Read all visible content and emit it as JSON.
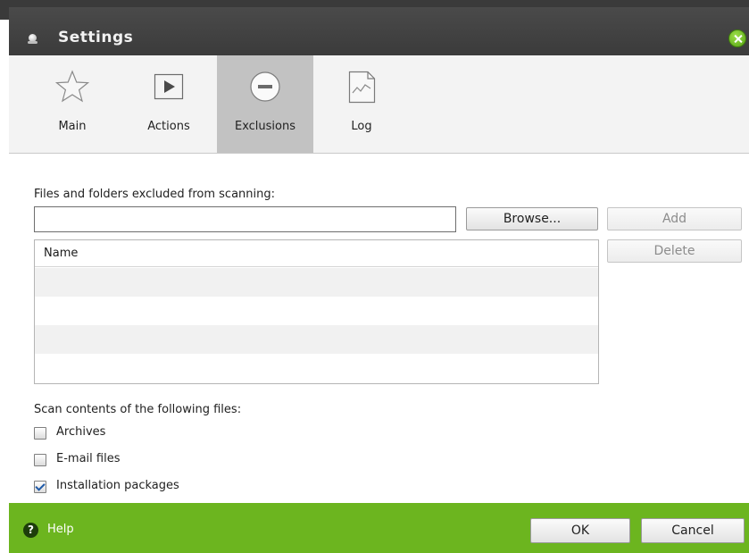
{
  "window": {
    "title": "Settings"
  },
  "toolbar": {
    "tabs": [
      {
        "label": "Main",
        "icon": "star-icon",
        "active": false
      },
      {
        "label": "Actions",
        "icon": "play-icon",
        "active": false
      },
      {
        "label": "Exclusions",
        "icon": "minus-circle-icon",
        "active": true
      },
      {
        "label": "Log",
        "icon": "document-chart-icon",
        "active": false
      }
    ]
  },
  "exclusions": {
    "section_label": "Files and folders excluded from scanning:",
    "path_value": "",
    "browse_label": "Browse...",
    "add_label": "Add",
    "delete_label": "Delete",
    "list_header": "Name",
    "rows": []
  },
  "scan_contents": {
    "label": "Scan contents of the following files:",
    "options": [
      {
        "label": "Archives",
        "checked": false
      },
      {
        "label": "E-mail files",
        "checked": false
      },
      {
        "label": "Installation packages",
        "checked": true
      }
    ]
  },
  "footer": {
    "help_label": "Help",
    "ok_label": "OK",
    "cancel_label": "Cancel"
  },
  "colors": {
    "titlebar": "#3b3b3b",
    "footer_green": "#6cb51f",
    "active_tab": "#c2c2c2",
    "checkmark": "#1f5aa8"
  }
}
